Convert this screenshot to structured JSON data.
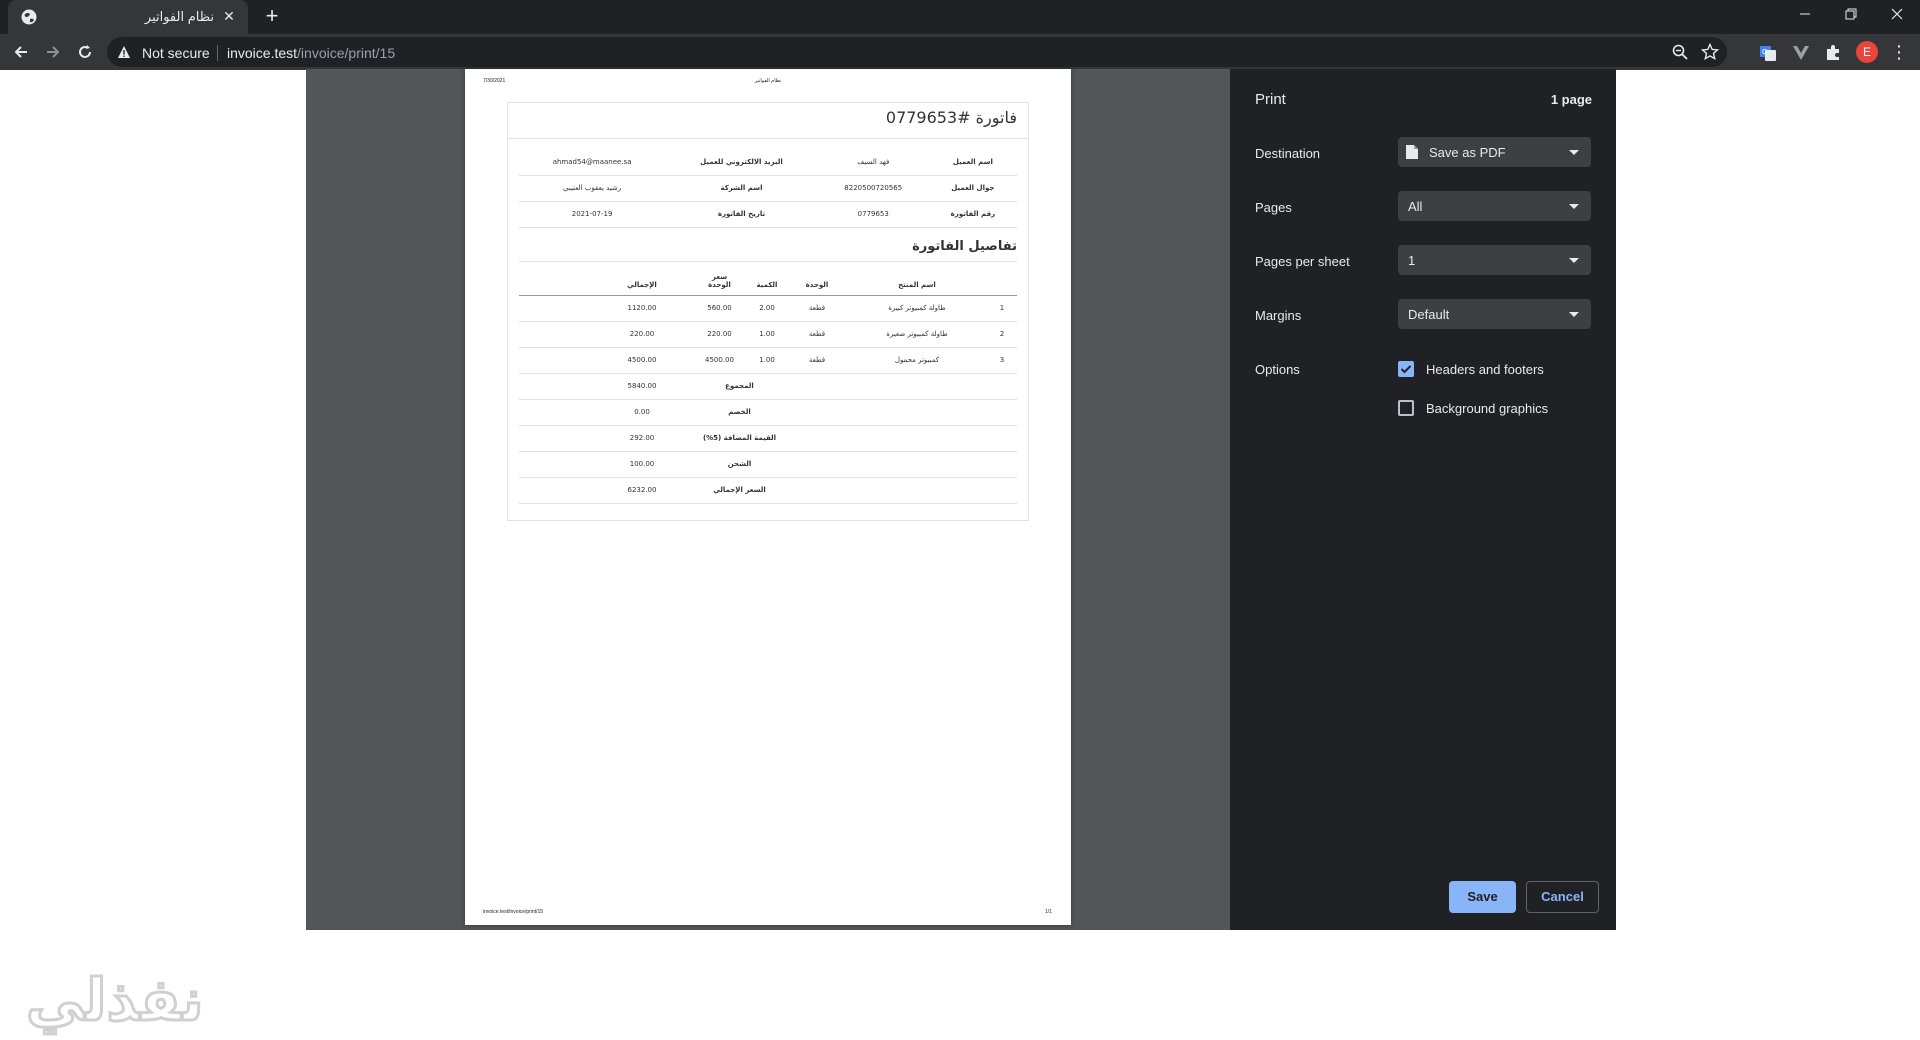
{
  "browser": {
    "tab_title": "نظام الفواتير",
    "security_label": "Not secure",
    "url_host": "invoice.test",
    "url_path": "/invoice/print/15",
    "avatar_letter": "E"
  },
  "print": {
    "title": "Print",
    "page_count": "1 page",
    "destination_label": "Destination",
    "destination_value": "Save as PDF",
    "pages_label": "Pages",
    "pages_value": "All",
    "pps_label": "Pages per sheet",
    "pps_value": "1",
    "margins_label": "Margins",
    "margins_value": "Default",
    "options_label": "Options",
    "opt_headers": "Headers and footers",
    "opt_headers_checked": true,
    "opt_background": "Background graphics",
    "opt_background_checked": false,
    "save": "Save",
    "cancel": "Cancel"
  },
  "page": {
    "header_date": "7/30/2021",
    "header_title": "نظام الفواتير",
    "footer_url": "invoice.test/invoice/print/15",
    "footer_page": "1/1"
  },
  "invoice": {
    "title": "فاتورة #0779653",
    "info": [
      {
        "k1": "اسم العميل",
        "v1": "فهد السيف",
        "k2": "البريد الالكتروني للعميل",
        "v2": "ahmad54@maanee.sa"
      },
      {
        "k1": "جوال العميل",
        "v1": "8220500720565",
        "k2": "اسم الشركة",
        "v2": "رشيد يعقوب العتيبي"
      },
      {
        "k1": "رقم الفاتورة",
        "v1": "0779653",
        "k2": "تاريخ الفاتورة",
        "v2": "2021-07-19"
      }
    ],
    "details_title": "تفاصيل الفاتورة",
    "columns": {
      "num": "",
      "product": "اسم المنتج",
      "unit": "الوحدة",
      "qty": "الكمية",
      "price_l1": "سعر",
      "price_l2": "الوحدة",
      "total": "الإجمالي"
    },
    "items": [
      {
        "num": "1",
        "product": "طاولة كمبيوتر كبيرة",
        "unit": "قطعة",
        "qty": "2.00",
        "price": "560.00",
        "total": "1120.00"
      },
      {
        "num": "2",
        "product": "طاولة كمبيوتر صغيرة",
        "unit": "قطعة",
        "qty": "1.00",
        "price": "220.00",
        "total": "220.00"
      },
      {
        "num": "3",
        "product": "كمبيوتر محمول",
        "unit": "قطعة",
        "qty": "1.00",
        "price": "4500.00",
        "total": "4500.00"
      }
    ],
    "summary": [
      {
        "label": "المجموع",
        "value": "5840.00"
      },
      {
        "label": "الخصم",
        "value": "0.00"
      },
      {
        "label": "القيمة المضافة (5%)",
        "value": "292.00"
      },
      {
        "label": "الشحن",
        "value": "100.00"
      },
      {
        "label": "السعر الإجمالي",
        "value": "6232.00"
      }
    ]
  },
  "watermark": "نفذلي",
  "colors": {
    "accent": "#8ab4f8",
    "dialog_bg": "#202124",
    "preview_bg": "#525659"
  }
}
